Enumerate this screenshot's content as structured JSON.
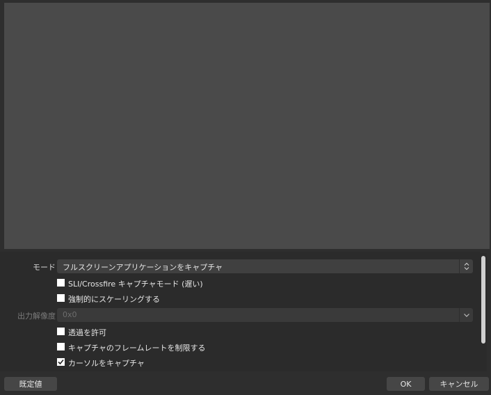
{
  "properties": {
    "mode": {
      "label": "モード",
      "value": "フルスクリーンアプリケーションをキャプチャ"
    },
    "sli_crossfire": {
      "label": "SLI/Crossfire キャプチャモード (遅い)",
      "checked": false
    },
    "force_scaling": {
      "label": "強制的にスケーリングする",
      "checked": false
    },
    "output_resolution": {
      "label": "出力解像度",
      "value": "0x0"
    },
    "allow_transparency": {
      "label": "透過を許可",
      "checked": false
    },
    "limit_framerate": {
      "label": "キャプチャのフレームレートを制限する",
      "checked": false
    },
    "capture_cursor": {
      "label": "カーソルをキャプチャ",
      "checked": true
    }
  },
  "buttons": {
    "defaults": "既定値",
    "ok": "OK",
    "cancel": "キャンセル"
  },
  "colors": {
    "preview_bg": "#4a4a4a",
    "window_bg": "#2e2e2e",
    "control_bg": "#404040"
  },
  "icons": {
    "mode_combo_arrow": "updown-arrows-icon",
    "resolution_combo_arrow": "chevron-down-icon",
    "checkmark": "check-icon"
  }
}
